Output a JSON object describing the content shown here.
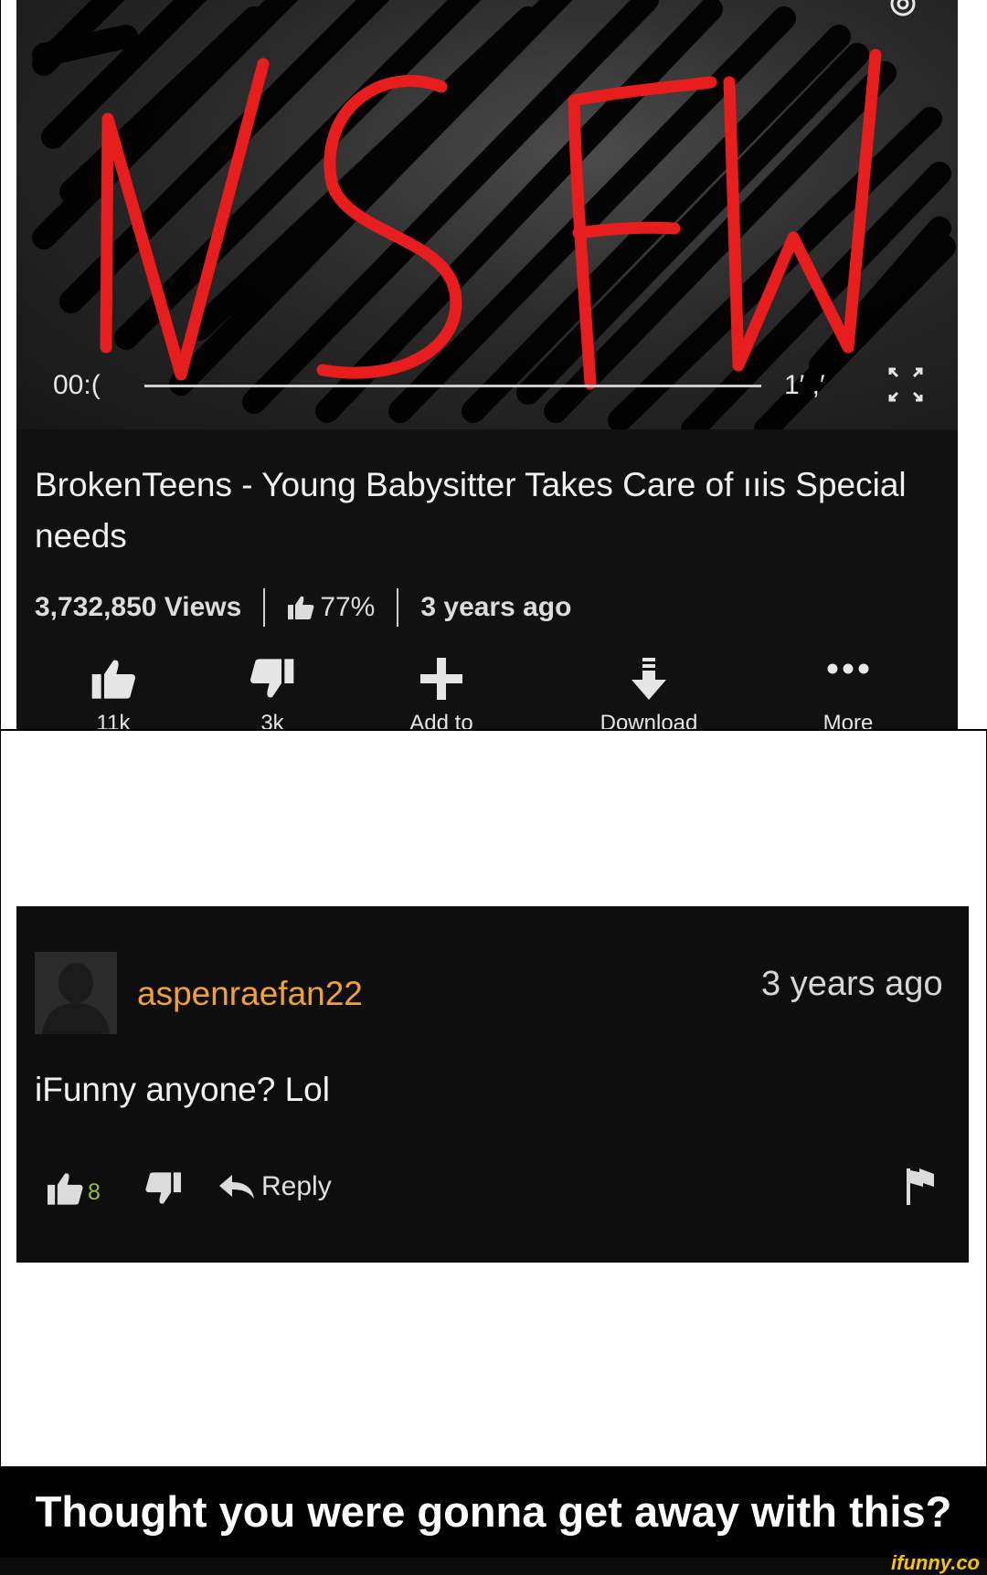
{
  "video": {
    "time_current": "00:(",
    "time_total": "1′ ,′",
    "title": "BrokenTeens - Young Babysitter Takes Care of ııis Special needs",
    "views": "3,732,850 Views",
    "rating": "77%",
    "age": "3 years ago",
    "actions": [
      {
        "label": "11k",
        "icon": "thumbs-up-icon"
      },
      {
        "label": "3k",
        "icon": "thumbs-down-icon"
      },
      {
        "label": "Add to",
        "icon": "plus-icon"
      },
      {
        "label": "Download",
        "icon": "download-icon"
      },
      {
        "label": "More",
        "icon": "more-dots-icon"
      }
    ],
    "overlay_text": "NSFW"
  },
  "comment": {
    "username": "aspenraefan22",
    "time": "3 years ago",
    "text": "iFunny anyone? Lol",
    "like_count": "8",
    "reply_label": "Reply"
  },
  "caption": "Thought you were gonna get away with this?",
  "watermark": "ifunny.co",
  "colors": {
    "nsfw_red": "#e81e1e",
    "username_orange": "#f0a233",
    "like_green": "#8fc13a",
    "watermark_yellow": "#f7c400"
  }
}
